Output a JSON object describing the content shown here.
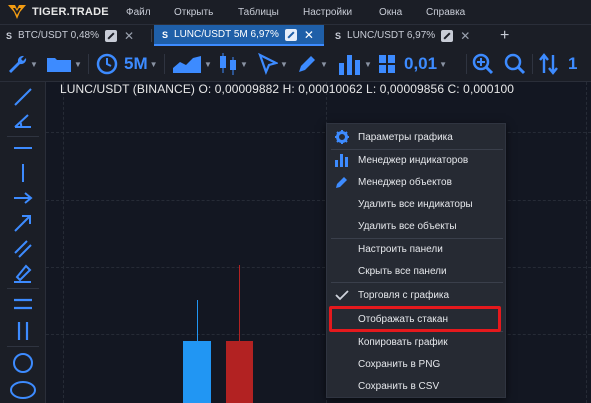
{
  "app": {
    "name": "TIGER.TRADE"
  },
  "menu": [
    "Файл",
    "Открыть",
    "Таблицы",
    "Настройки",
    "Окна",
    "Справка"
  ],
  "tabs": [
    {
      "badge": "S",
      "label": "BTC/USDT 0,48%"
    },
    {
      "badge": "S",
      "label": "LUNC/USDT 5M 6,97%"
    },
    {
      "badge": "S",
      "label": "LUNC/USDT 6,97%"
    }
  ],
  "toolbar": {
    "timeframe": "5M",
    "tick_size": "0,01",
    "extra": "1"
  },
  "ohlc": "LUNC/USDT (BINANCE) O: 0,00009882  H: 0,00010062  L: 0,00009856  C: 0,000100",
  "context_menu": {
    "items": [
      "Параметры графика",
      "Менеджер индикаторов",
      "Менеджер объектов",
      "Удалить все индикаторы",
      "Удалить все объекты",
      "Настроить панели",
      "Скрыть все панели",
      "Торговля с графика",
      "Отображать стакан",
      "Копировать график",
      "Сохранить в PNG",
      "Сохранить в CSV"
    ]
  },
  "colors": {
    "accent": "#3d8bff",
    "bull": "#2196f3",
    "bear": "#b22222",
    "highlight": "#e5191d"
  }
}
